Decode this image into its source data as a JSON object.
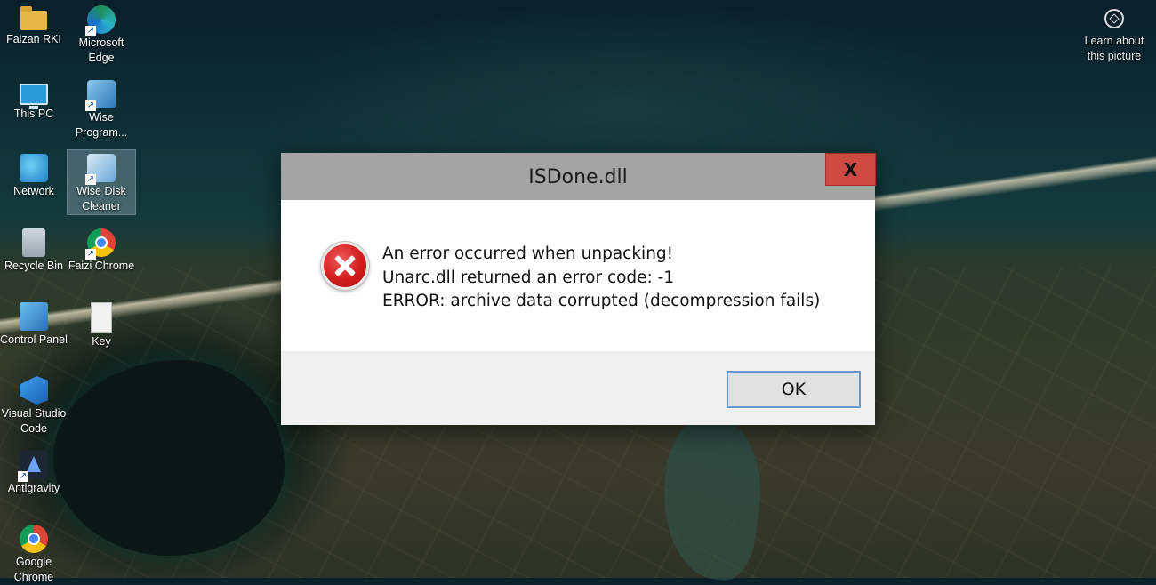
{
  "desktop": {
    "icons": [
      {
        "label": "Faizan RKI",
        "icon": "folder-icon"
      },
      {
        "label": "Microsoft Edge",
        "icon": "edge-icon"
      },
      {
        "label": "This PC",
        "icon": "computer-icon"
      },
      {
        "label": "Wise Program...",
        "icon": "wise-program-uninstaller-icon"
      },
      {
        "label": "Network",
        "icon": "network-icon"
      },
      {
        "label": "Wise Disk Cleaner",
        "icon": "wise-disk-cleaner-icon"
      },
      {
        "label": "Recycle Bin",
        "icon": "recycle-bin-icon"
      },
      {
        "label": "Faizi Chrome",
        "icon": "chrome-icon"
      },
      {
        "label": "Control Panel",
        "icon": "control-panel-icon"
      },
      {
        "label": "Key",
        "icon": "text-file-icon"
      },
      {
        "label": "Visual Studio Code",
        "icon": "vscode-icon"
      },
      {
        "label": "Antigravity",
        "icon": "antigravity-icon"
      },
      {
        "label": "Google Chrome",
        "icon": "chrome-icon"
      }
    ],
    "learn_about": {
      "label": "Learn about this picture",
      "icon": "camera-icon"
    }
  },
  "dialog": {
    "title": "ISDone.dll",
    "close_label": "X",
    "icon": "error-icon",
    "messages": [
      "An error occurred when unpacking!",
      "Unarc.dll returned an error code: -1",
      "ERROR: archive data corrupted (decompression fails)"
    ],
    "ok_label": "OK"
  },
  "colors": {
    "titlebar": "#a4a4a4",
    "close_button": "#cf4a43",
    "footer": "#f0f0f0",
    "ok_border": "#6a98c9",
    "error_red": "#d21c1c"
  }
}
